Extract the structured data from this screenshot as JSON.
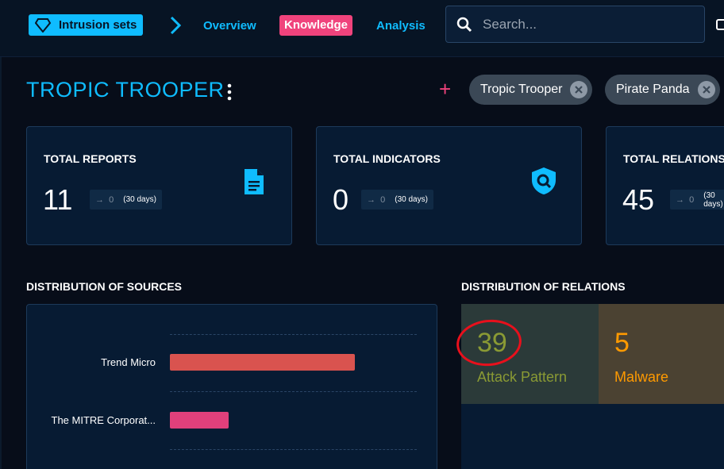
{
  "nav": {
    "breadcrumb_label": "Intrusion sets",
    "links": [
      "Overview",
      "Knowledge",
      "Analysis"
    ],
    "active": "Knowledge",
    "search_placeholder": "Search..."
  },
  "entity": {
    "title": "TROPIC TROOPER",
    "aliases": [
      "Tropic Trooper",
      "Pirate Panda"
    ]
  },
  "cards": [
    {
      "label": "TOTAL REPORTS",
      "value": "11",
      "delta": "0",
      "period": "(30 days)",
      "icon": "file-document-icon"
    },
    {
      "label": "TOTAL INDICATORS",
      "value": "0",
      "delta": "0",
      "period": "(30 days)",
      "icon": "shield-search-icon"
    },
    {
      "label": "TOTAL RELATIONS",
      "value": "45",
      "delta": "0",
      "period": "(30 days)"
    }
  ],
  "sources": {
    "heading": "DISTRIBUTION OF SOURCES",
    "chart_data": {
      "type": "bar",
      "categories": [
        "Trend Micro",
        "The MITRE Corporat..."
      ],
      "values": [
        11,
        3.5
      ],
      "colors": [
        "#d9534f",
        "#e0407b"
      ]
    }
  },
  "relations": {
    "heading": "DISTRIBUTION OF RELATIONS",
    "tiles": [
      {
        "count": "39",
        "name": "Attack Pattern",
        "color": "#8a9a34",
        "bg": "#2b3a39"
      },
      {
        "count": "5",
        "name": "Malware",
        "color": "#ff9a00",
        "bg": "#4b4232"
      }
    ]
  },
  "colors": {
    "accent": "#0fbcff",
    "secondary": "#f0437c",
    "annotation": "#e8101c"
  }
}
